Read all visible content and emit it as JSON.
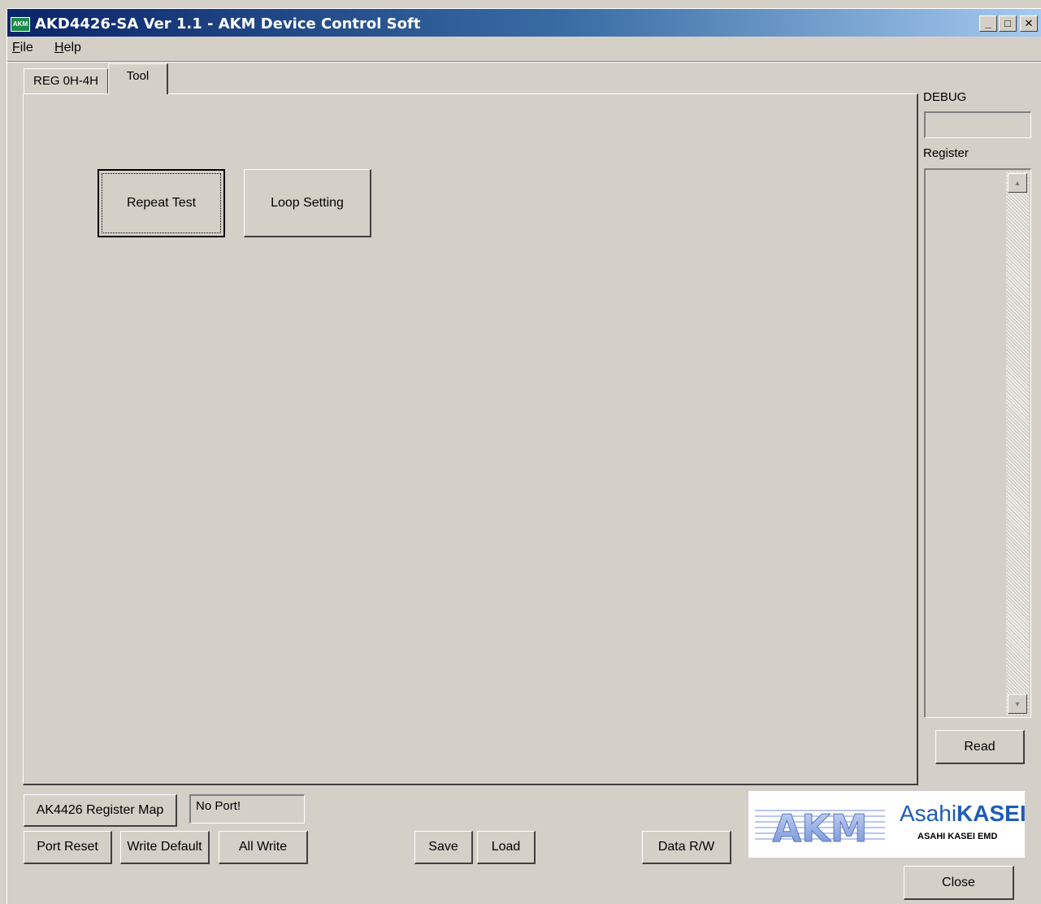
{
  "window": {
    "title": "AKD4426-SA Ver 1.1 - AKM Device Control Soft",
    "icon_text": "AKM",
    "controls": [
      "_",
      "□",
      "✕"
    ]
  },
  "menu": {
    "items": [
      {
        "label_first": "F",
        "label_rest": "ile"
      },
      {
        "label_first": "H",
        "label_rest": "elp"
      }
    ]
  },
  "tabs": [
    {
      "label": "REG 0H-4H",
      "selected": false
    },
    {
      "label": "Tool",
      "selected": true
    }
  ],
  "tool_panel": {
    "buttons": {
      "repeat_test": "Repeat Test",
      "loop_setting": "Loop Setting"
    }
  },
  "side_panel": {
    "debug_label": "DEBUG",
    "debug_value": "",
    "register_label": "Register",
    "read_button": "Read"
  },
  "bottom": {
    "register_map_button": "AK4426 Register Map",
    "port_status": "No Port!",
    "port_reset": "Port Reset",
    "write_default": "Write Default",
    "all_write": "All Write",
    "save": "Save",
    "load": "Load",
    "data_rw": "Data R/W",
    "close": "Close"
  },
  "logo": {
    "akm_text": "AKM",
    "asahi_light": "Asahi",
    "asahi_bold": "KASEI",
    "emd": "ASAHI KASEI EMD"
  }
}
